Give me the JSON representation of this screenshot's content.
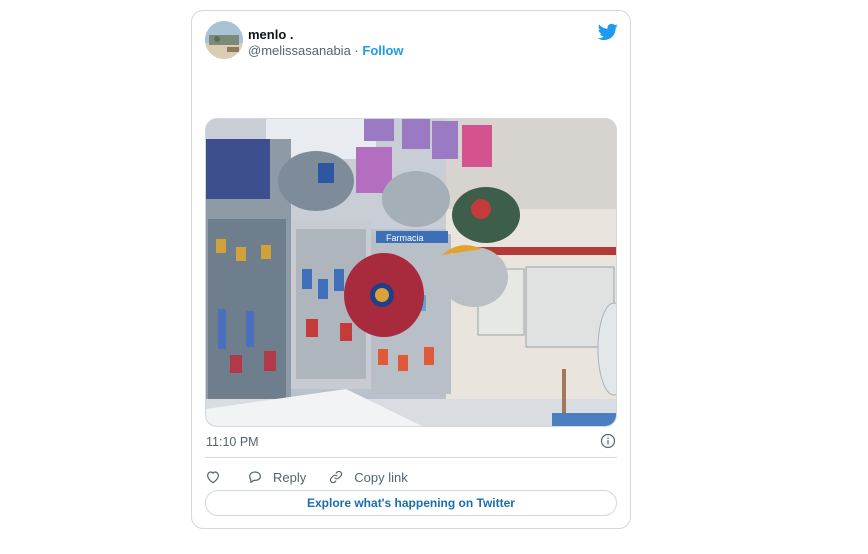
{
  "tweet": {
    "author": {
      "display_name": "menlo .",
      "handle": "@melissasanabia",
      "separator": " · ",
      "follow_label": "Follow"
    },
    "media": {
      "sign_text": "Farmacia",
      "description_icons": "photo-of-pharmacy-with-hanging-caps"
    },
    "timestamp": "11:10 PM",
    "actions": {
      "like_icon": "heart-icon",
      "reply_label": "Reply",
      "copy_link_label": "Copy link"
    },
    "explore_label": "Explore what's happening on Twitter"
  },
  "colors": {
    "accent": "#1d9bf0",
    "text_secondary": "#536471",
    "border": "#cfd9de"
  }
}
